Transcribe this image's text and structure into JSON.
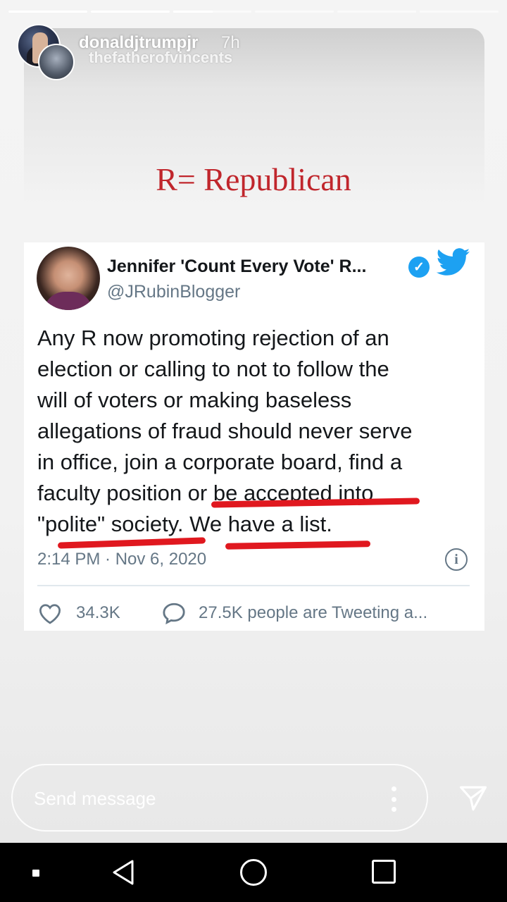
{
  "story": {
    "progress_segments": [
      1,
      1,
      0.5,
      0,
      0,
      0
    ],
    "username": "donaldjtrumpjr",
    "time_ago": "7h",
    "reposted_from": "thefatherofvincents",
    "caption": "R= Republican"
  },
  "tweet": {
    "author_name": "Jennifer 'Count Every Vote' R...",
    "handle": "@JRubinBlogger",
    "verified_mark": "✓",
    "body_lines": [
      "Any R now promoting rejection of an",
      "election or calling to not to follow the",
      "will of voters or making baseless",
      "allegations of fraud should never serve",
      "in office, join a corporate board, find a",
      "faculty position or be accepted into",
      "\"polite\" society. We have a list."
    ],
    "timestamp": "2:14 PM · Nov 6, 2020",
    "info_glyph": "i",
    "likes": "34.3K",
    "talking": "27.5K people are Tweeting a..."
  },
  "message_bar": {
    "placeholder": "Send message"
  },
  "colors": {
    "caption_red": "#c0262c",
    "highlight_red": "#e0181f",
    "twitter_blue": "#1da1f2",
    "muted_gray": "#657786"
  },
  "icons": [
    "heart-icon",
    "comment-bubble-icon",
    "info-icon",
    "verified-badge-icon",
    "twitter-bird-icon",
    "more-vertical-icon",
    "send-icon",
    "nav-back-icon",
    "nav-home-icon",
    "nav-recents-icon"
  ]
}
